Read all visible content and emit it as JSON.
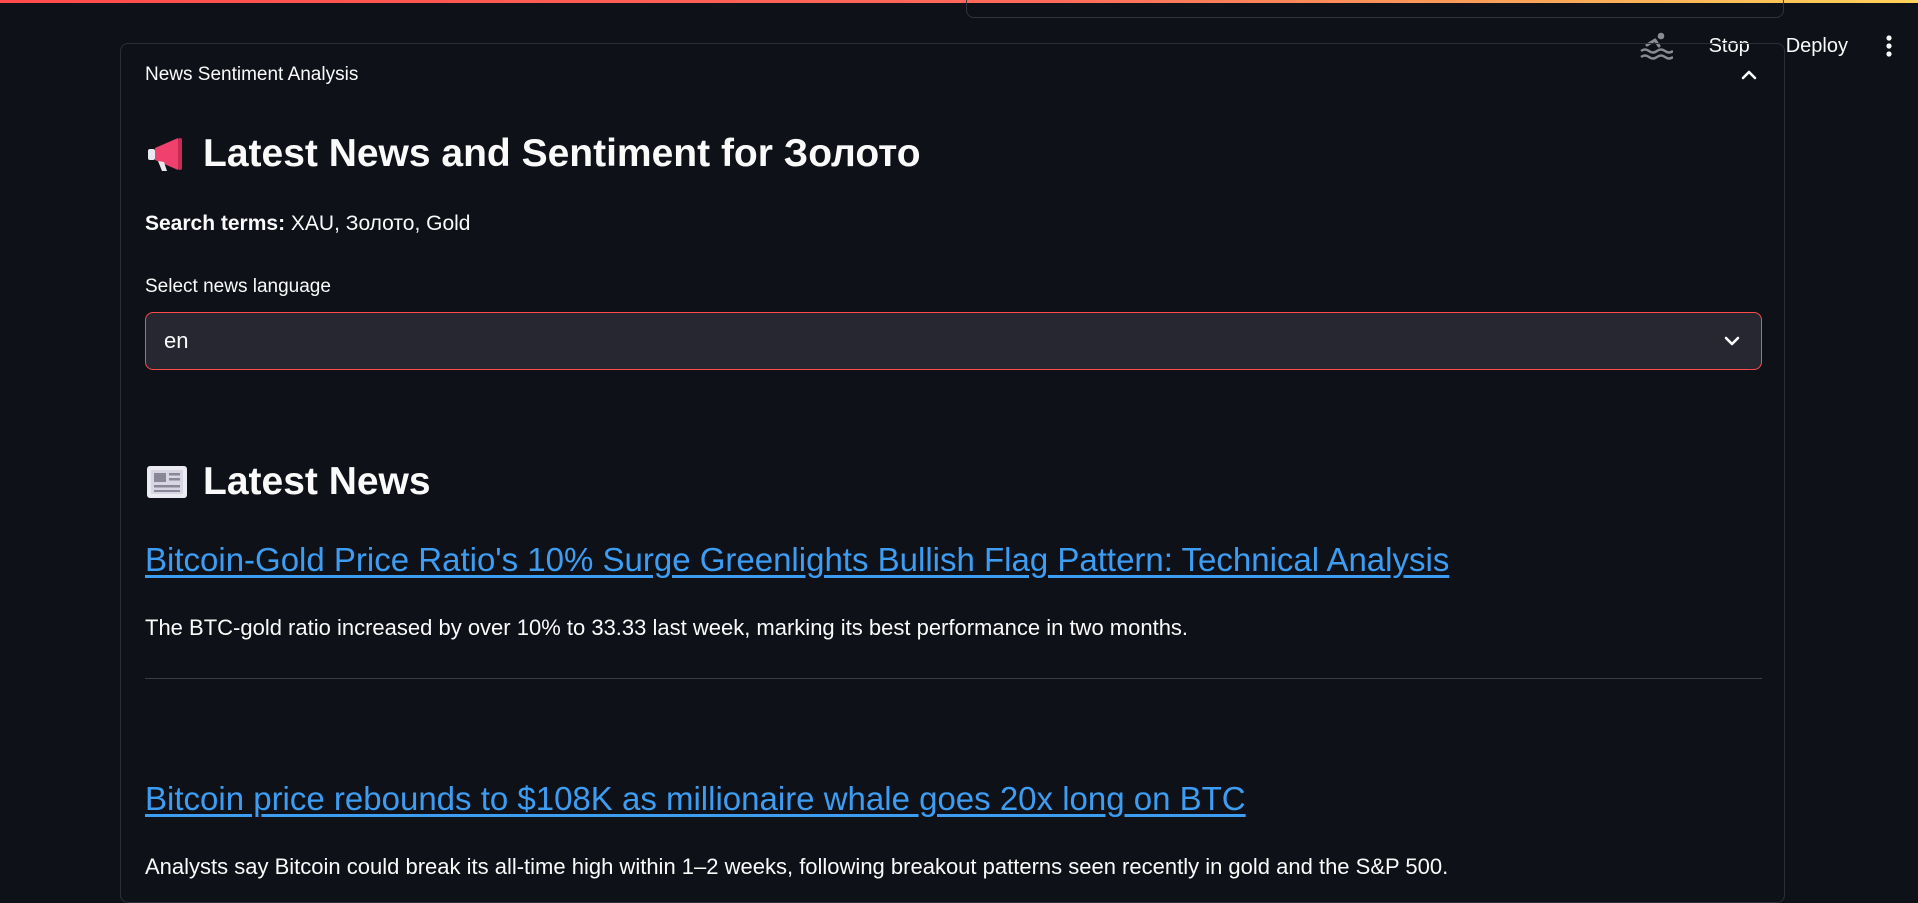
{
  "toolbar": {
    "stop_label": "Stop",
    "deploy_label": "Deploy",
    "running_icon": "swimmer-icon",
    "menu_icon": "vertical-dots-icon"
  },
  "expander": {
    "title": "News Sentiment Analysis",
    "state_icon": "chevron-up-icon"
  },
  "main": {
    "heading_emoji": "megaphone-icon",
    "heading": "Latest News and Sentiment for Золото",
    "search_terms_label": "Search terms:",
    "search_terms_value": "XAU, Золото, Gold",
    "language_label": "Select news language",
    "language_value": "en",
    "news_heading_emoji": "newspaper-icon",
    "news_heading": "Latest News"
  },
  "news": [
    {
      "title": "Bitcoin-Gold Price Ratio's 10% Surge Greenlights Bullish Flag Pattern: Technical Analysis",
      "description": "The BTC-gold ratio increased by over 10% to 33.33 last week, marking its best performance in two months."
    },
    {
      "title": "Bitcoin price rebounds to $108K as millionaire whale goes 20x long on BTC",
      "description": "Analysts say Bitcoin could break its all-time high within 1–2 weeks, following breakout patterns seen recently in gold and the S&P 500."
    }
  ],
  "colors": {
    "background": "#0e1117",
    "link": "#3d9df3",
    "accent": "#ff4b4b",
    "select_bg": "#262730"
  }
}
